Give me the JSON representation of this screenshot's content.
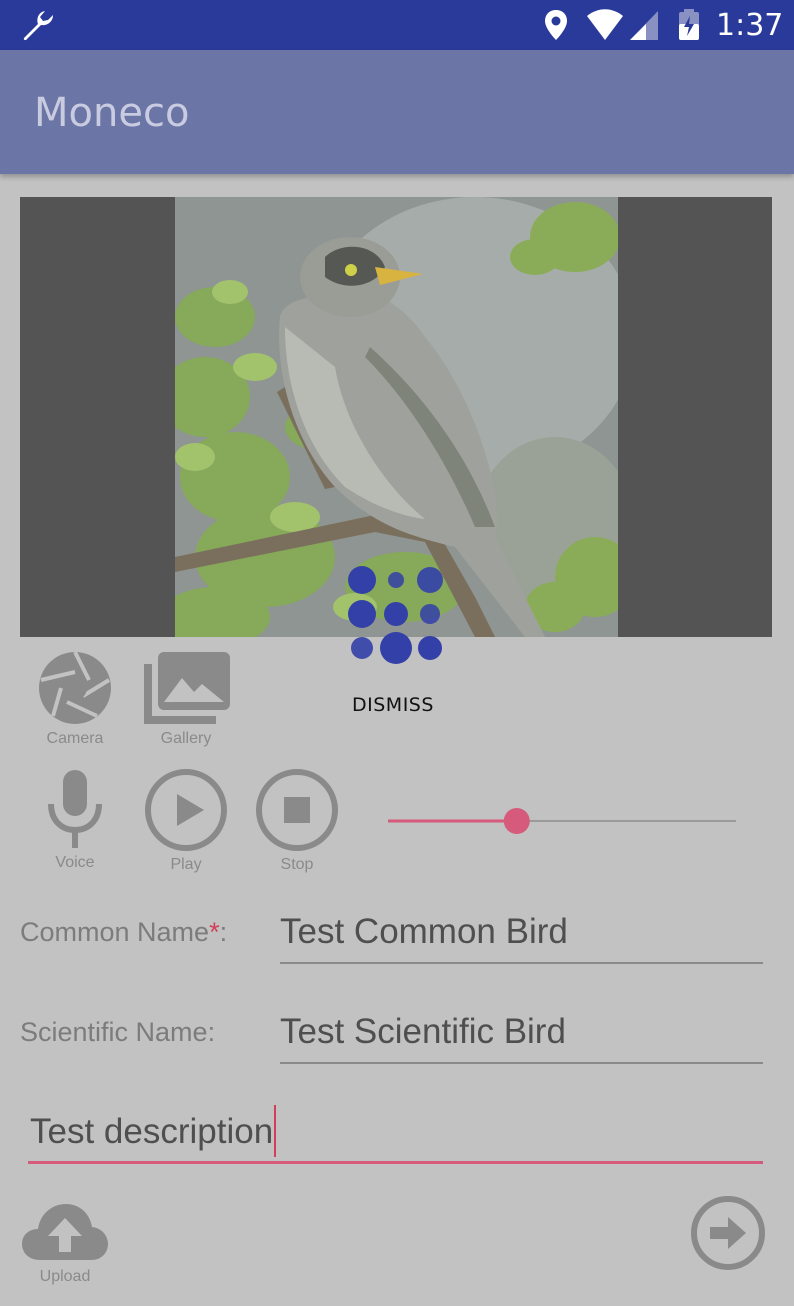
{
  "status_bar": {
    "time": "1:37"
  },
  "app_bar": {
    "title": "Moneco"
  },
  "progress": {
    "dismiss_label": "DISMISS"
  },
  "media_tools": {
    "camera_label": "Camera",
    "gallery_label": "Gallery",
    "voice_label": "Voice",
    "play_label": "Play",
    "stop_label": "Stop"
  },
  "audio_slider": {
    "position_fraction": 0.37,
    "accent_color": "#d65a7c"
  },
  "form": {
    "common_name_label": "Common Name",
    "required_marker": "*",
    "label_suffix": ":",
    "common_name_value": "Test Common Bird",
    "scientific_name_label": "Scientific Name:",
    "scientific_name_value": "Test Scientific Bird",
    "description_value": "Test description"
  },
  "bottom_bar": {
    "upload_label": "Upload"
  },
  "colors": {
    "status_bar": "#2a3a9a",
    "app_bar": "#6c76a6",
    "overlay_background": "#c2c2c2",
    "spinner": "#3340a8"
  }
}
